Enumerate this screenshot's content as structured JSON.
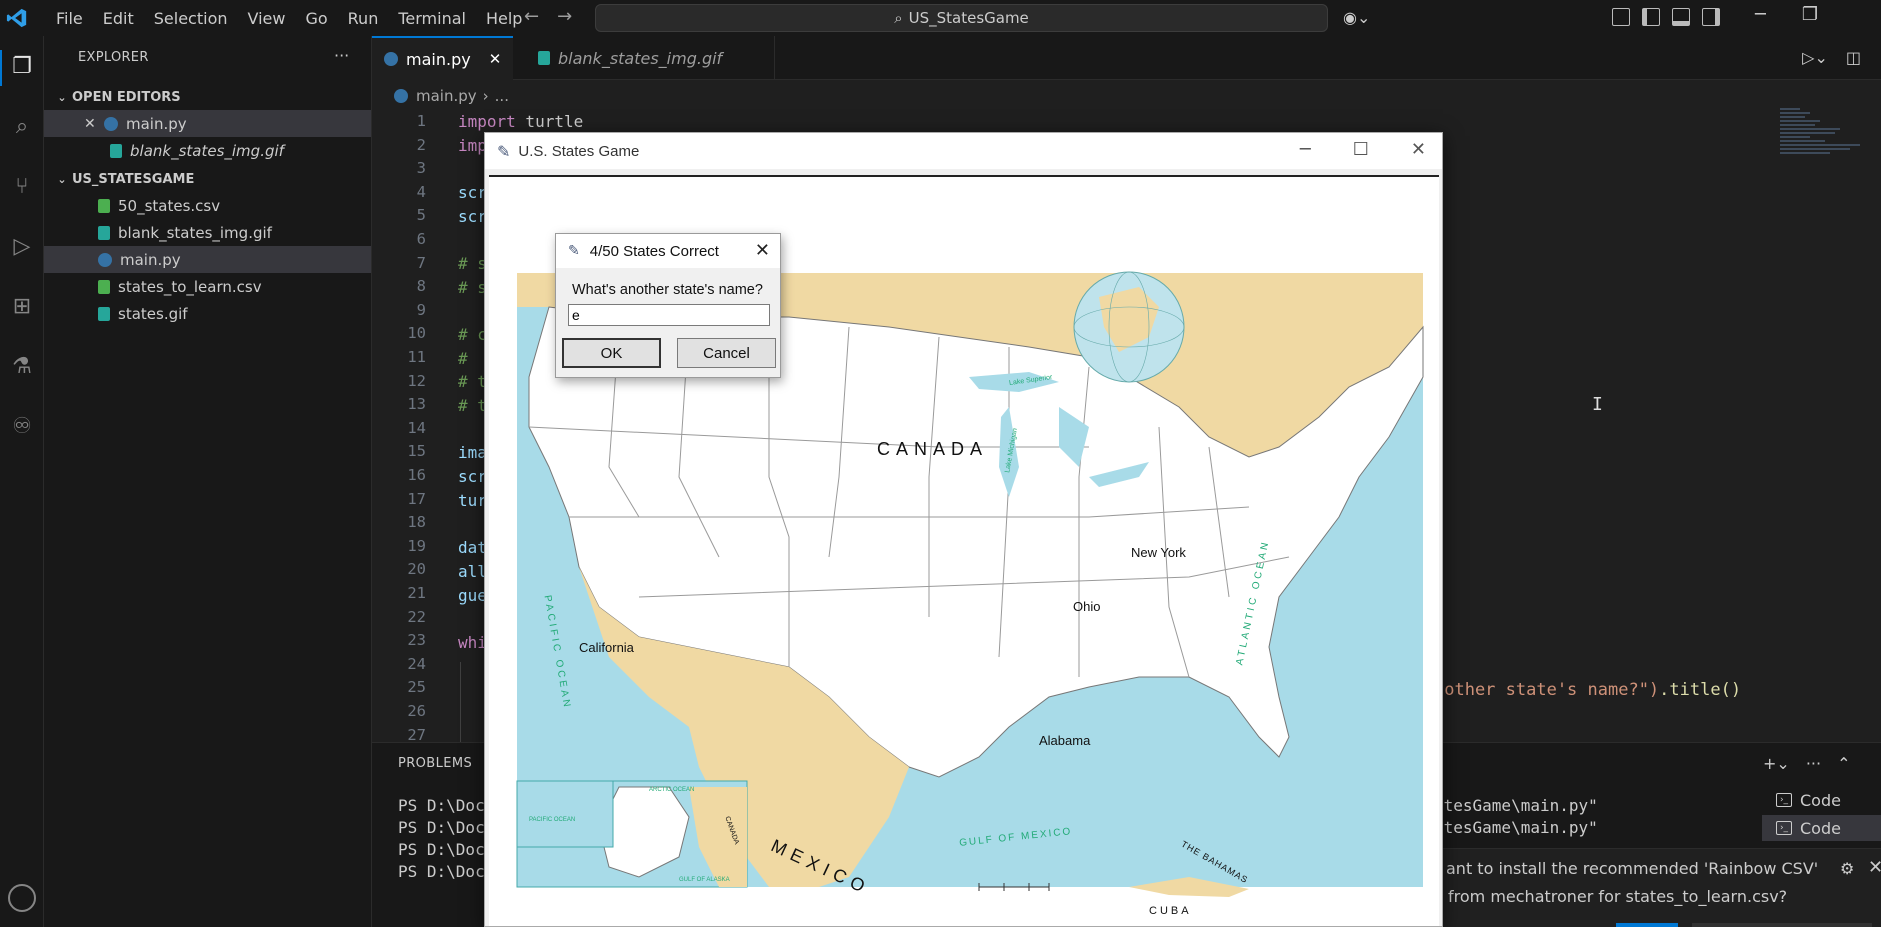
{
  "titlebar": {
    "menu": [
      "File",
      "Edit",
      "Selection",
      "View",
      "Go",
      "Run",
      "Terminal",
      "Help"
    ],
    "search_text": "US_StatesGame"
  },
  "sidebar": {
    "title": "EXPLORER",
    "open_editors_label": "OPEN EDITORS",
    "open_editors": [
      {
        "name": "main.py",
        "type": "py"
      },
      {
        "name": "blank_states_img.gif",
        "type": "gif"
      }
    ],
    "folder_label": "US_STATESGAME",
    "files": [
      {
        "name": "50_states.csv",
        "type": "csv"
      },
      {
        "name": "blank_states_img.gif",
        "type": "gif"
      },
      {
        "name": "main.py",
        "type": "py"
      },
      {
        "name": "states_to_learn.csv",
        "type": "csv"
      },
      {
        "name": "states.gif",
        "type": "gif"
      }
    ]
  },
  "tabs": [
    {
      "label": "main.py",
      "active": true
    },
    {
      "label": "blank_states_img.gif",
      "active": false
    }
  ],
  "breadcrumb": {
    "file": "main.py",
    "rest": "..."
  },
  "editor": {
    "line_numbers": [
      "1",
      "2",
      "3",
      "4",
      "5",
      "6",
      "7",
      "8",
      "9",
      "10",
      "11",
      "12",
      "13",
      "14",
      "15",
      "16",
      "17",
      "18",
      "19",
      "20",
      "21",
      "22",
      "23",
      "24",
      "25",
      "26",
      "27"
    ],
    "visible_lines": {
      "l1": {
        "kw": "import",
        "rest": " turtle"
      },
      "l2": "imp",
      "l4": "scr",
      "l5": "scr",
      "l7": "# s",
      "l8": "# s",
      "l10": "# c",
      "l11": "#",
      "l12": "# t",
      "l13": "# t",
      "l15": "ima",
      "l16": "scr",
      "l17": "tur",
      "l19": "dat",
      "l20": "all",
      "l21": "gue",
      "l23": "whi"
    },
    "right_fragment": {
      "str": "nother state's name?\")",
      "rest": ".title()"
    }
  },
  "panel": {
    "title": "PROBLEMS",
    "terminal_lines": [
      "PS D:\\Docu",
      "PS D:\\Docu",
      "PS D:\\Docu",
      "PS D:\\Docu"
    ],
    "terminal_right": [
      "atesGame\\main.py\"",
      "atesGame\\main.py\""
    ],
    "terminals": [
      "Code",
      "Code"
    ]
  },
  "notification": {
    "line1": "ant to install the recommended 'Rainbow CSV'",
    "line2": "from mechatroner for states_to_learn.csv?"
  },
  "game": {
    "window_title": "U.S. States Game",
    "map_labels": {
      "canada": "CANADA",
      "mexico": "MEXICO",
      "pacific": "PACIFIC OCEAN",
      "atlantic": "ATLANTIC OCEAN",
      "gulf": "GULF OF MEXICO",
      "bahamas": "THE BAHAMAS",
      "cuba": "CUBA",
      "lake_superior": "Lake Superior",
      "lake_michigan": "Lake Michigan",
      "arctic": "ARCTIC OCEAN",
      "gulf_alaska": "GULF OF ALASKA",
      "pacific_small": "PACIFIC OCEAN",
      "canada_small": "CANADA"
    },
    "guessed_states": {
      "new_york": "New York",
      "ohio": "Ohio",
      "california": "California",
      "alabama": "Alabama"
    },
    "dialog": {
      "title": "4/50 States Correct",
      "prompt": "What's another state's name?",
      "input_value": "e",
      "ok_label": "OK",
      "cancel_label": "Cancel"
    }
  },
  "colors": {
    "accent": "#0078d4",
    "ocean": "#a8dbe8",
    "land_foreign": "#f0d9a3"
  }
}
